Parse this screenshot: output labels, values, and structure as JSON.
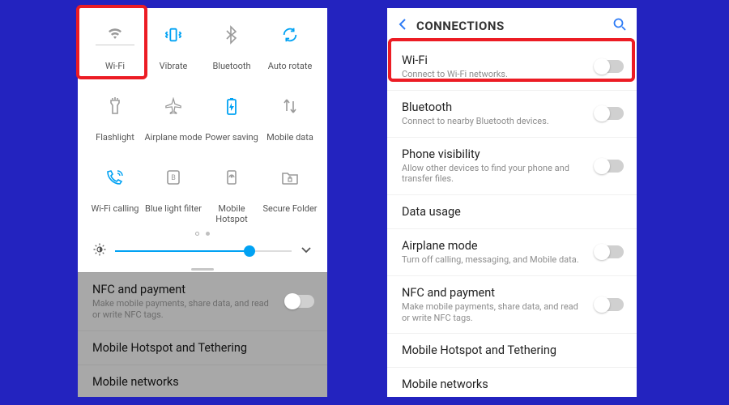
{
  "quick_settings": {
    "tiles": [
      {
        "label": "Wi-Fi",
        "icon": "wifi",
        "on": false
      },
      {
        "label": "Vibrate",
        "icon": "vibrate",
        "on": true
      },
      {
        "label": "Bluetooth",
        "icon": "bluetooth",
        "on": false
      },
      {
        "label": "Auto rotate",
        "icon": "rotate",
        "on": true
      },
      {
        "label": "Flashlight",
        "icon": "flashlight",
        "on": false
      },
      {
        "label": "Airplane mode",
        "icon": "airplane",
        "on": false
      },
      {
        "label": "Power saving",
        "icon": "battery",
        "on": true
      },
      {
        "label": "Mobile data",
        "icon": "data",
        "on": false
      },
      {
        "label": "Wi-Fi calling",
        "icon": "wificall",
        "on": true
      },
      {
        "label": "Blue light filter",
        "icon": "bluelight",
        "on": false
      },
      {
        "label": "Mobile Hotspot",
        "icon": "hotspot",
        "on": false
      },
      {
        "label": "Secure Folder",
        "icon": "secure",
        "on": false
      }
    ],
    "brightness_percent": 76
  },
  "shaded_rows": [
    {
      "title": "NFC and payment",
      "desc": "Make mobile payments, share data, and read or write NFC tags.",
      "toggle": true
    },
    {
      "title": "Mobile Hotspot and Tethering"
    },
    {
      "title": "Mobile networks"
    }
  ],
  "settings": {
    "header": "CONNECTIONS",
    "rows": [
      {
        "title": "Wi-Fi",
        "desc": "Connect to Wi-Fi networks.",
        "toggle": true
      },
      {
        "title": "Bluetooth",
        "desc": "Connect to nearby Bluetooth devices.",
        "toggle": true
      },
      {
        "title": "Phone visibility",
        "desc": "Allow other devices to find your phone and transfer files.",
        "toggle": true
      },
      {
        "title": "Data usage"
      },
      {
        "title": "Airplane mode",
        "desc": "Turn off calling, messaging, and Mobile data.",
        "toggle": true
      },
      {
        "title": "NFC and payment",
        "desc": "Make mobile payments, share data, and read or write NFC tags.",
        "toggle": true
      },
      {
        "title": "Mobile Hotspot and Tethering"
      },
      {
        "title": "Mobile networks"
      }
    ]
  }
}
